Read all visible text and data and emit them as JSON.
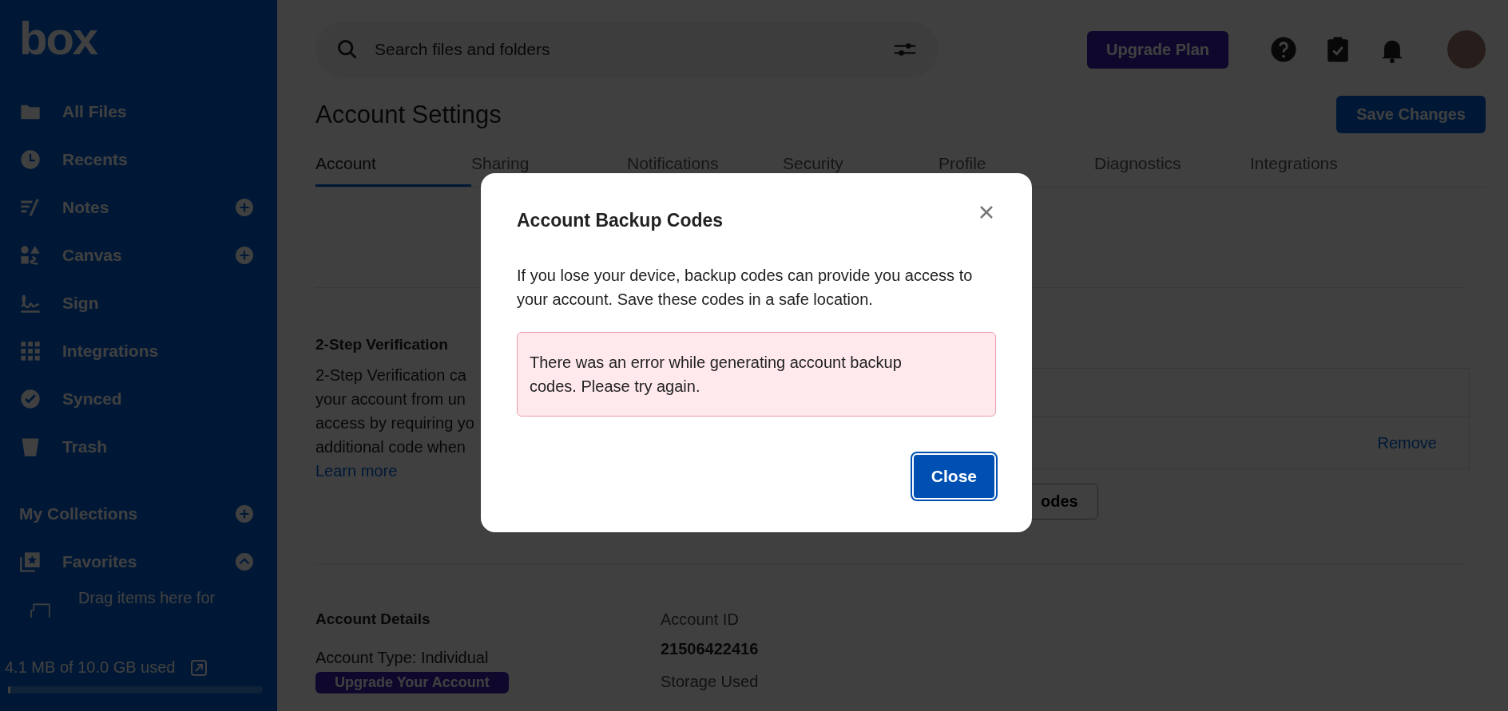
{
  "sidebar": {
    "logo": "box",
    "nav": [
      {
        "label": "All Files",
        "add": false
      },
      {
        "label": "Recents",
        "add": false
      },
      {
        "label": "Notes",
        "add": true
      },
      {
        "label": "Canvas",
        "add": true
      },
      {
        "label": "Sign",
        "add": false
      },
      {
        "label": "Integrations",
        "add": false
      },
      {
        "label": "Synced",
        "add": false
      },
      {
        "label": "Trash",
        "add": false
      }
    ],
    "collections": {
      "label": "My Collections"
    },
    "favorites": {
      "label": "Favorites",
      "expanded": true,
      "hint": "Drag items here for"
    },
    "storage": {
      "text": "4.1 MB of 10.0 GB used",
      "level": 0.01
    }
  },
  "topbar": {
    "search": {
      "placeholder": "Search files and folders"
    },
    "upgrade": "Upgrade Plan"
  },
  "page": {
    "title": "Account Settings",
    "save": "Save Changes",
    "tabs": [
      {
        "label": "Account",
        "selected": true
      },
      {
        "label": "Sharing",
        "selected": false
      },
      {
        "label": "Notifications",
        "selected": false
      },
      {
        "label": "Security",
        "selected": false
      },
      {
        "label": "Profile",
        "selected": false
      },
      {
        "label": "Diagnostics",
        "selected": false
      },
      {
        "label": "Integrations",
        "selected": false
      }
    ]
  },
  "two_step": {
    "title": "2-Step Verification",
    "lines": [
      "2-Step Verification ca",
      "your account from un",
      "access by requiring yo",
      "additional code when"
    ],
    "link": "Learn more",
    "row_action": "Remove",
    "button_fragment": "odes"
  },
  "account_details": {
    "title": "Account Details",
    "type": "Account Type: Individual",
    "upgrade": "Upgrade Your Account",
    "id_label": "Account ID",
    "id_value": "21506422416",
    "storage_label": "Storage Used"
  },
  "dialog": {
    "title": "Account Backup Codes",
    "body": "If you lose your device, backup codes can provide you access to your account. Save these codes in a safe location.",
    "error": "There was an error while generating account backup codes. Please try again.",
    "close": "Close"
  }
}
